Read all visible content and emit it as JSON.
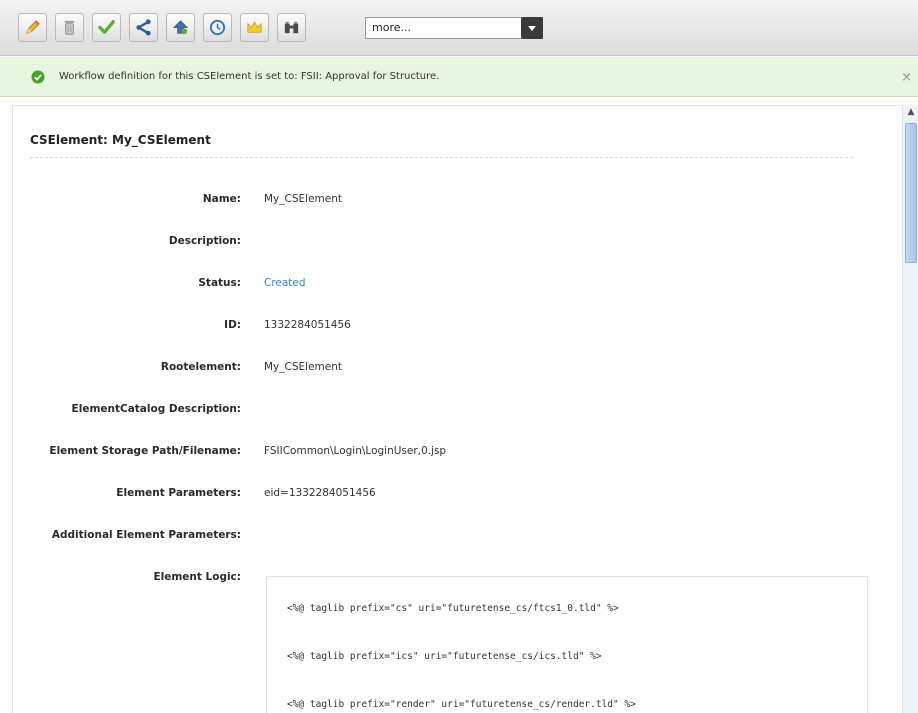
{
  "toolbar": {
    "buttons": [
      {
        "icon": "pencil-icon",
        "label": "edit"
      },
      {
        "icon": "trash-icon",
        "label": "delete"
      },
      {
        "icon": "checkmark-icon",
        "label": "approve"
      },
      {
        "icon": "share-icon",
        "label": "share"
      },
      {
        "icon": "bookmark-icon",
        "label": "bookmark"
      },
      {
        "icon": "clock-icon",
        "label": "history"
      },
      {
        "icon": "crown-icon",
        "label": "status"
      },
      {
        "icon": "binoculars-icon",
        "label": "search"
      }
    ],
    "more_select": {
      "value": "more..."
    }
  },
  "message": {
    "text": "Workflow definition for this CSElement is set to: FSII: Approval for Structure.",
    "close": "×"
  },
  "content": {
    "title": "CSElement: My_CSElement",
    "fields": [
      {
        "label": "Name:",
        "value": "My_CSElement"
      },
      {
        "label": "Description:",
        "value": ""
      },
      {
        "label": "Status:",
        "value": "Created"
      },
      {
        "label": "ID:",
        "value": "1332284051456"
      },
      {
        "label": "Rootelement:",
        "value": "My_CSElement"
      },
      {
        "label": "ElementCatalog Description:",
        "value": ""
      },
      {
        "label": "Element Storage Path/Filename:",
        "value": "FSIICommon\\Login\\LoginUser,0.jsp"
      },
      {
        "label": "Element Parameters:",
        "value": "eid=1332284051456"
      },
      {
        "label": "Additional Element Parameters:",
        "value": ""
      },
      {
        "label": "Element Logic:",
        "value": ""
      }
    ],
    "code_lines": [
      "<%@ taglib prefix=\"cs\" uri=\"futuretense_cs/ftcs1_0.tld\" %>",
      "<%@ taglib prefix=\"ics\" uri=\"futuretense_cs/ics.tld\" %>",
      "<%@ taglib prefix=\"render\" uri=\"futuretense_cs/render.tld\" %>"
    ]
  },
  "colors": {
    "message_bg": "#e8f6de",
    "status_link": "#3a7fc4",
    "success_green": "#4aa02c"
  }
}
